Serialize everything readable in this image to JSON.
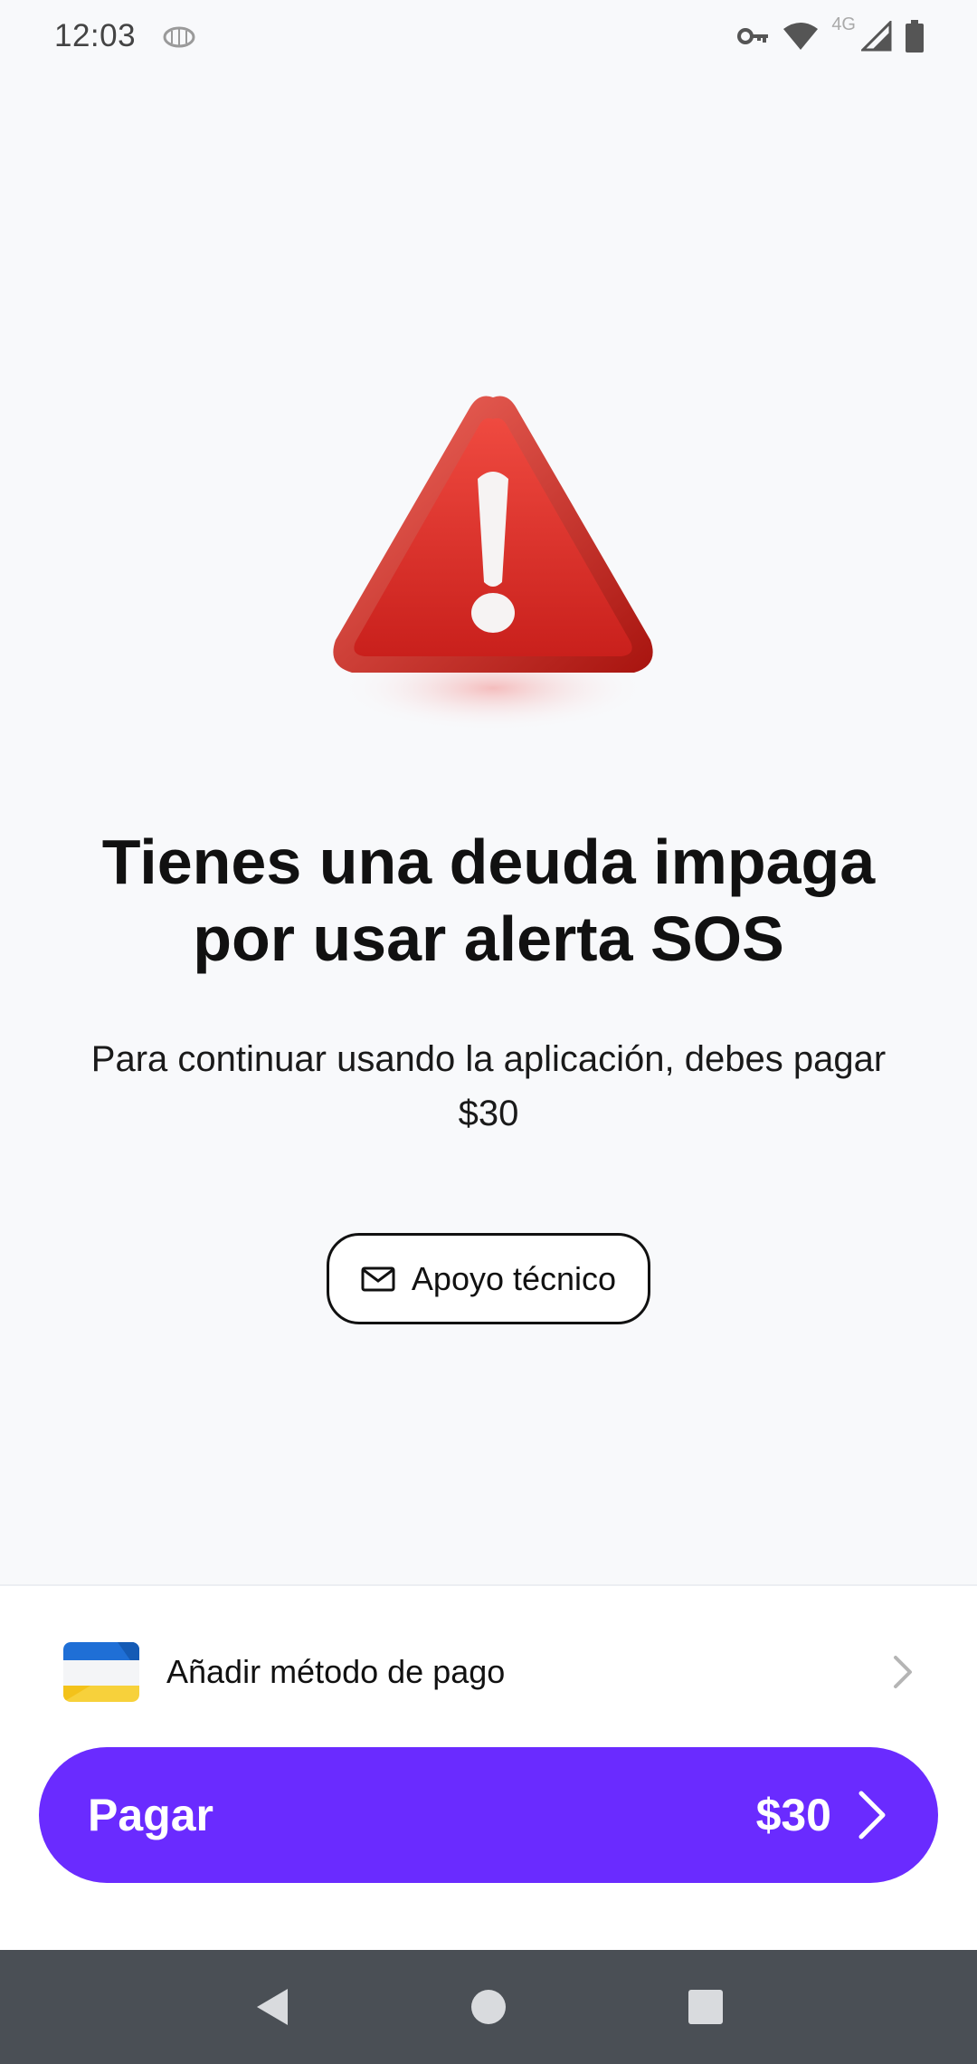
{
  "status_bar": {
    "time": "12:03",
    "network_label": "4G",
    "icons": [
      "bug-icon",
      "vpn-key-icon",
      "wifi-icon",
      "signal-icon",
      "battery-icon"
    ]
  },
  "alert": {
    "icon": "warning-triangle-icon",
    "title": "Tienes una deuda impaga por usar alerta SOS",
    "message": "Para continuar usando la aplicación, debes pagar $30",
    "support_button_label": "Apoyo técnico",
    "support_button_icon": "mail-icon"
  },
  "payment": {
    "add_method_label": "Añadir método de pago",
    "card_icon": "card-icon",
    "pay_button_label": "Pagar",
    "pay_amount": "$30"
  },
  "colors": {
    "accent": "#6a2bff",
    "background": "#f8f9fb",
    "warning_red": "#e0312b",
    "nav_bar": "#4a4f55"
  },
  "nav_bar": {
    "buttons": [
      "back-icon",
      "home-icon",
      "recents-icon"
    ]
  }
}
